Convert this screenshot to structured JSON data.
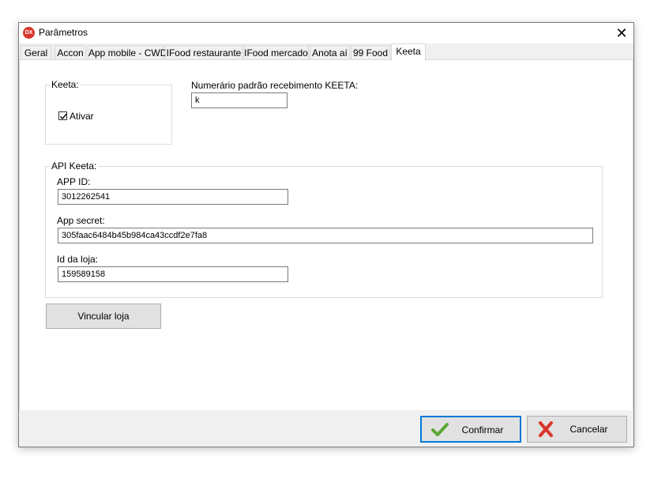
{
  "window": {
    "icon_text": "DX",
    "title": "Parâmetros",
    "close_glyph": "✕"
  },
  "tabs": [
    {
      "label": "Geral"
    },
    {
      "label": "Accon"
    },
    {
      "label": "App mobile - CWD"
    },
    {
      "label": "IFood restaurante"
    },
    {
      "label": "IFood mercado"
    },
    {
      "label": "Anota aí"
    },
    {
      "label": "99 Food"
    },
    {
      "label": "Keeta",
      "active": true
    }
  ],
  "keeta_group": {
    "legend": "Keeta:",
    "activate_label": "Ativar",
    "activate_checked": true
  },
  "numero_padrao": {
    "label": "Numerário padrão recebimento KEETA:",
    "value": "k"
  },
  "api_group": {
    "legend": "API Keeta:",
    "app_id_label": "APP ID:",
    "app_id_value": "3012262541",
    "app_secret_label": "App secret:",
    "app_secret_value": "305faac6484b45b984ca43ccdf2e7fa8",
    "store_id_label": "Id da loja:",
    "store_id_value": "159589158"
  },
  "link_store_button": "Vincular loja",
  "footer": {
    "confirm_label": "Confirmar",
    "cancel_label": "Cancelar"
  },
  "colors": {
    "confirm_icon": "#5aa832",
    "cancel_icon": "#d9362b",
    "focus_border": "#0078d7"
  }
}
